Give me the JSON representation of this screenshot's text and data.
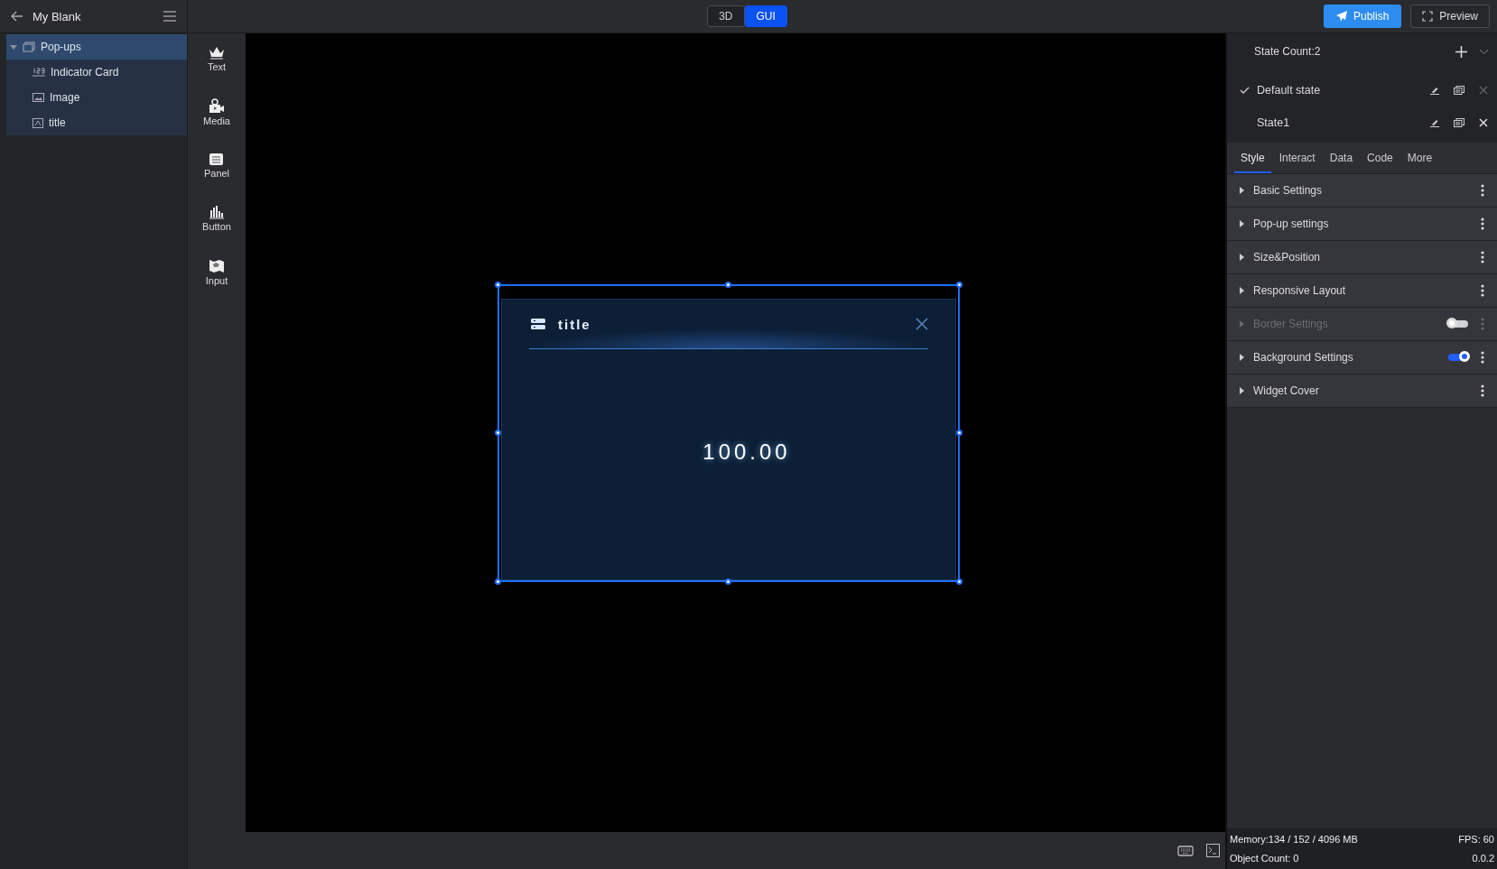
{
  "header": {
    "title": "My Blank"
  },
  "mode_switch": [
    {
      "label": "3D",
      "selected": false
    },
    {
      "label": "GUI",
      "selected": true
    }
  ],
  "actions": [
    {
      "kind": "publish",
      "label": "Publish"
    },
    {
      "kind": "preview",
      "label": "Preview"
    }
  ],
  "layers": [
    {
      "label": "Pop-ups",
      "kind": "group",
      "selected": true,
      "expanded": true,
      "children": [
        {
          "label": "Indicator Card",
          "kind": "number",
          "selected": false
        },
        {
          "label": "Image",
          "kind": "image",
          "selected": false
        },
        {
          "label": "title",
          "kind": "text",
          "selected": false
        }
      ]
    }
  ],
  "tools": [
    {
      "kind": "text",
      "label": "Text"
    },
    {
      "kind": "media",
      "label": "Media"
    },
    {
      "kind": "panel",
      "label": "Panel"
    },
    {
      "kind": "button",
      "label": "Button"
    },
    {
      "kind": "input",
      "label": "Input"
    }
  ],
  "popup": {
    "title": "title",
    "value": "100.00"
  },
  "states": {
    "count_label": "State Count:2",
    "items": [
      {
        "label": "Default state",
        "checked": true,
        "deletable": false
      },
      {
        "label": "State1",
        "checked": false,
        "deletable": true
      }
    ]
  },
  "tabs": [
    {
      "label": "Style",
      "selected": true
    },
    {
      "label": "Interact",
      "selected": false
    },
    {
      "label": "Data",
      "selected": false
    },
    {
      "label": "Code",
      "selected": false
    },
    {
      "label": "More",
      "selected": false
    }
  ],
  "settings": [
    {
      "label": "Basic Settings",
      "kind": "plain",
      "disabled": false
    },
    {
      "label": "Pop-up settings",
      "kind": "plain",
      "disabled": false
    },
    {
      "label": "Size&Position",
      "kind": "plain",
      "disabled": false
    },
    {
      "label": "Responsive Layout",
      "kind": "plain",
      "disabled": false
    },
    {
      "label": "Border Settings",
      "kind": "toggle",
      "on": false,
      "disabled": true
    },
    {
      "label": "Background Settings",
      "kind": "toggle",
      "on": true,
      "disabled": false
    },
    {
      "label": "Widget Cover",
      "kind": "plain",
      "disabled": false
    }
  ],
  "status": {
    "memory": "Memory:134 / 152 / 4096 MB",
    "fps": "FPS: 60",
    "objects": "Object Count: 0",
    "version": "0.0.2"
  }
}
